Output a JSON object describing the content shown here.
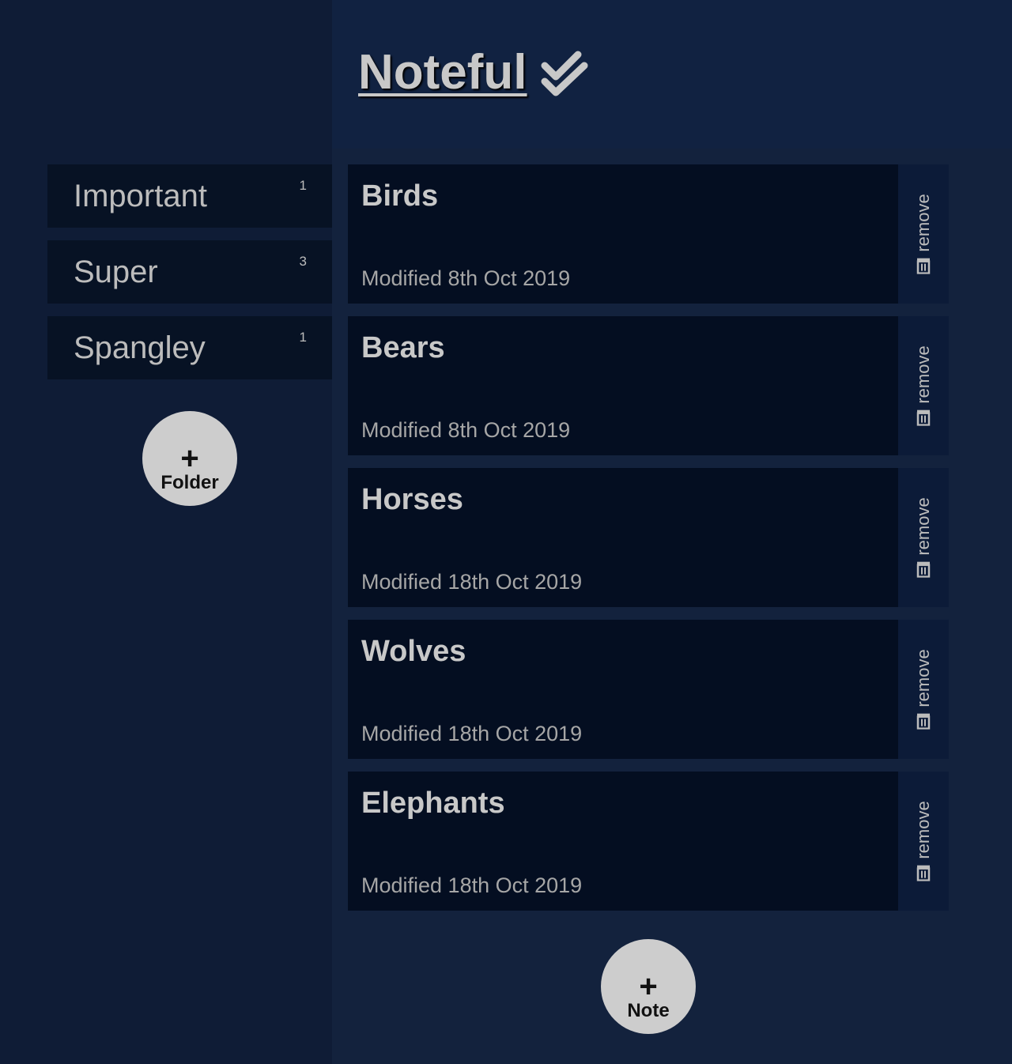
{
  "header": {
    "title": "Noteful",
    "icon": "double-check-icon"
  },
  "sidebar": {
    "folders": [
      {
        "name": "Important",
        "count": "1"
      },
      {
        "name": "Super",
        "count": "3"
      },
      {
        "name": "Spangley",
        "count": "1"
      }
    ],
    "add_folder": {
      "plus": "+",
      "label": "Folder"
    }
  },
  "main": {
    "notes": [
      {
        "title": "Birds",
        "modified": "Modified 8th Oct 2019"
      },
      {
        "title": "Bears",
        "modified": "Modified 8th Oct 2019"
      },
      {
        "title": "Horses",
        "modified": "Modified 18th Oct 2019"
      },
      {
        "title": "Wolves",
        "modified": "Modified 18th Oct 2019"
      },
      {
        "title": "Elephants",
        "modified": "Modified 18th Oct 2019"
      }
    ],
    "remove_label": "remove",
    "remove_icon": "trash-icon",
    "add_note": {
      "plus": "+",
      "label": "Note"
    }
  },
  "colors": {
    "sidebar_bg": "#0f1c36",
    "main_bg": "#13223d",
    "card_bg": "#040e21",
    "button_bg": "#cdcdcd",
    "text": "#c8c8c8"
  }
}
